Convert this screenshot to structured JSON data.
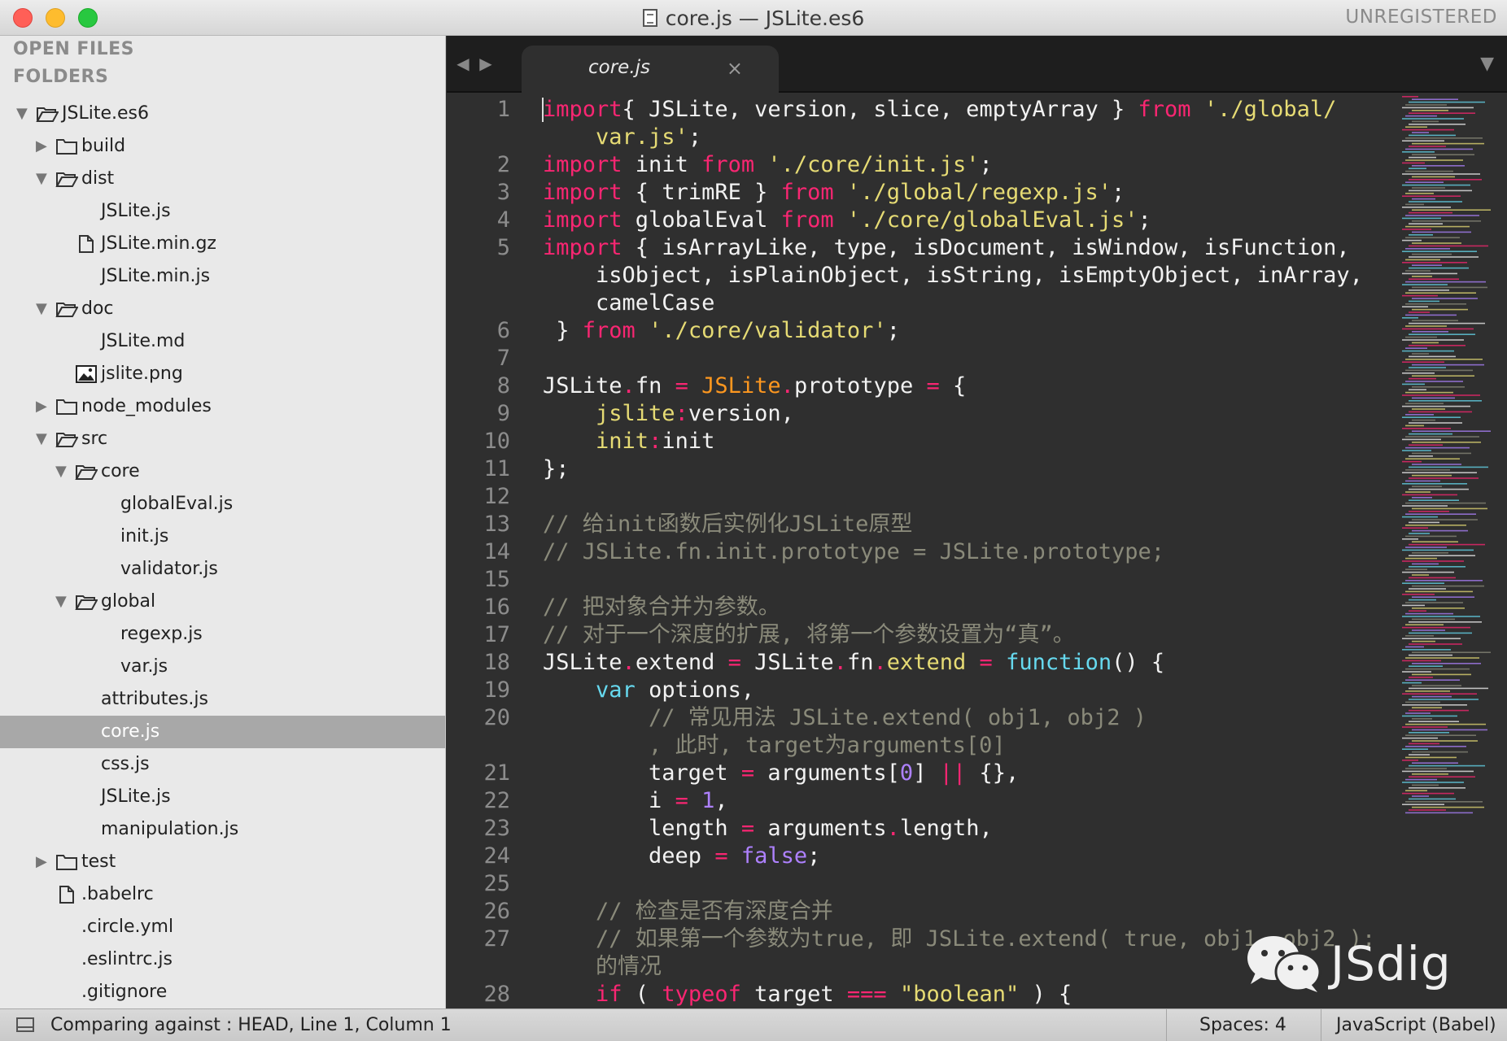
{
  "window": {
    "title": "core.js — JSLite.es6",
    "unregistered": "UNREGISTERED"
  },
  "sidebar": {
    "open_files_header": "OPEN FILES",
    "folders_header": "FOLDERS",
    "tree": [
      {
        "label": "JSLite.es6",
        "type": "folder-open",
        "depth": 0
      },
      {
        "label": "build",
        "type": "folder-closed",
        "depth": 1
      },
      {
        "label": "dist",
        "type": "folder-open",
        "depth": 1
      },
      {
        "label": "JSLite.js",
        "type": "file",
        "depth": 2
      },
      {
        "label": "JSLite.min.gz",
        "type": "file-icon",
        "depth": 2
      },
      {
        "label": "JSLite.min.js",
        "type": "file",
        "depth": 2
      },
      {
        "label": "doc",
        "type": "folder-open",
        "depth": 1
      },
      {
        "label": "JSLite.md",
        "type": "file",
        "depth": 2
      },
      {
        "label": "jslite.png",
        "type": "image-icon",
        "depth": 2
      },
      {
        "label": "node_modules",
        "type": "folder-closed",
        "depth": 1
      },
      {
        "label": "src",
        "type": "folder-open",
        "depth": 1
      },
      {
        "label": "core",
        "type": "folder-open",
        "depth": 2
      },
      {
        "label": "globalEval.js",
        "type": "file",
        "depth": 3
      },
      {
        "label": "init.js",
        "type": "file",
        "depth": 3
      },
      {
        "label": "validator.js",
        "type": "file",
        "depth": 3
      },
      {
        "label": "global",
        "type": "folder-open",
        "depth": 2
      },
      {
        "label": "regexp.js",
        "type": "file",
        "depth": 3
      },
      {
        "label": "var.js",
        "type": "file",
        "depth": 3
      },
      {
        "label": "attributes.js",
        "type": "file",
        "depth": 2
      },
      {
        "label": "core.js",
        "type": "file",
        "depth": 2,
        "selected": true
      },
      {
        "label": "css.js",
        "type": "file",
        "depth": 2
      },
      {
        "label": "JSLite.js",
        "type": "file",
        "depth": 2
      },
      {
        "label": "manipulation.js",
        "type": "file",
        "depth": 2
      },
      {
        "label": "test",
        "type": "folder-closed",
        "depth": 1
      },
      {
        "label": ".babelrc",
        "type": "file-icon",
        "depth": 1
      },
      {
        "label": ".circle.yml",
        "type": "file",
        "depth": 1
      },
      {
        "label": ".eslintrc.js",
        "type": "file",
        "depth": 1
      },
      {
        "label": ".gitignore",
        "type": "file",
        "depth": 1
      }
    ]
  },
  "editor": {
    "tab_label": "core.js",
    "tab_close": "×",
    "lines": [
      {
        "num": "1",
        "tokens": [
          [
            "k",
            "import"
          ],
          [
            "",
            "{ JSLite, version, slice, emptyArray } "
          ],
          [
            "k",
            "from"
          ],
          [
            "",
            " "
          ],
          [
            "s",
            "'./global/"
          ]
        ]
      },
      {
        "num": "",
        "tokens": [
          [
            "s",
            "    var.js'"
          ],
          [
            "",
            ";"
          ]
        ]
      },
      {
        "num": "2",
        "tokens": [
          [
            "k",
            "import"
          ],
          [
            "",
            " init "
          ],
          [
            "k",
            "from"
          ],
          [
            "",
            " "
          ],
          [
            "s",
            "'./core/init.js'"
          ],
          [
            "",
            ";"
          ]
        ]
      },
      {
        "num": "3",
        "tokens": [
          [
            "k",
            "import"
          ],
          [
            "",
            " { trimRE } "
          ],
          [
            "k",
            "from"
          ],
          [
            "",
            " "
          ],
          [
            "s",
            "'./global/regexp.js'"
          ],
          [
            "",
            ";"
          ]
        ]
      },
      {
        "num": "4",
        "tokens": [
          [
            "k",
            "import"
          ],
          [
            "",
            " globalEval "
          ],
          [
            "k",
            "from"
          ],
          [
            "",
            " "
          ],
          [
            "s",
            "'./core/globalEval.js'"
          ],
          [
            "",
            ";"
          ]
        ]
      },
      {
        "num": "5",
        "tokens": [
          [
            "k",
            "import"
          ],
          [
            "",
            " { isArrayLike, type, isDocument, isWindow, isFunction,"
          ]
        ]
      },
      {
        "num": "",
        "tokens": [
          [
            "",
            "    isObject, isPlainObject, isString, isEmptyObject, inArray,"
          ]
        ]
      },
      {
        "num": "",
        "tokens": [
          [
            "",
            "    camelCase"
          ]
        ]
      },
      {
        "num": "6",
        "tokens": [
          [
            "",
            " } "
          ],
          [
            "k",
            "from"
          ],
          [
            "",
            " "
          ],
          [
            "s",
            "'./core/validator'"
          ],
          [
            "",
            ";"
          ]
        ]
      },
      {
        "num": "7",
        "tokens": [
          [
            "",
            ""
          ]
        ]
      },
      {
        "num": "8",
        "tokens": [
          [
            "",
            "JSLite"
          ],
          [
            "o",
            "."
          ],
          [
            "",
            "fn "
          ],
          [
            "o",
            "="
          ],
          [
            "",
            " "
          ],
          [
            "p",
            "JSLite"
          ],
          [
            "o",
            "."
          ],
          [
            "",
            "prototype "
          ],
          [
            "o",
            "="
          ],
          [
            "",
            " {"
          ]
        ]
      },
      {
        "num": "9",
        "tokens": [
          [
            "",
            "    "
          ],
          [
            "s",
            "jslite"
          ],
          [
            "o",
            ":"
          ],
          [
            "",
            "version,"
          ]
        ]
      },
      {
        "num": "10",
        "tokens": [
          [
            "",
            "    "
          ],
          [
            "s",
            "init"
          ],
          [
            "o",
            ":"
          ],
          [
            "",
            "init"
          ]
        ]
      },
      {
        "num": "11",
        "tokens": [
          [
            "",
            "};"
          ]
        ]
      },
      {
        "num": "12",
        "tokens": [
          [
            "",
            ""
          ]
        ]
      },
      {
        "num": "13",
        "tokens": [
          [
            "c",
            "// 给init函数后实例化JSLite原型"
          ]
        ]
      },
      {
        "num": "14",
        "tokens": [
          [
            "c",
            "// JSLite.fn.init.prototype = JSLite.prototype;"
          ]
        ]
      },
      {
        "num": "15",
        "tokens": [
          [
            "",
            ""
          ]
        ]
      },
      {
        "num": "16",
        "tokens": [
          [
            "c",
            "// 把对象合并为参数。"
          ]
        ]
      },
      {
        "num": "17",
        "tokens": [
          [
            "c",
            "// 对于一个深度的扩展, 将第一个参数设置为“真”。"
          ]
        ]
      },
      {
        "num": "18",
        "tokens": [
          [
            "",
            "JSLite"
          ],
          [
            "o",
            "."
          ],
          [
            "",
            "extend "
          ],
          [
            "o",
            "="
          ],
          [
            "",
            " JSLite"
          ],
          [
            "o",
            "."
          ],
          [
            "",
            "fn"
          ],
          [
            "o",
            "."
          ],
          [
            "s",
            "extend"
          ],
          [
            "",
            " "
          ],
          [
            "o",
            "="
          ],
          [
            "",
            " "
          ],
          [
            "f",
            "function"
          ],
          [
            "",
            "() {"
          ]
        ]
      },
      {
        "num": "19",
        "tokens": [
          [
            "",
            "    "
          ],
          [
            "f",
            "var"
          ],
          [
            "",
            " options,"
          ]
        ]
      },
      {
        "num": "20",
        "tokens": [
          [
            "c",
            "        // 常见用法 JSLite.extend( obj1, obj2 )"
          ]
        ]
      },
      {
        "num": "",
        "tokens": [
          [
            "c",
            "        , 此时, target为arguments[0]"
          ]
        ]
      },
      {
        "num": "21",
        "tokens": [
          [
            "",
            "        target "
          ],
          [
            "o",
            "="
          ],
          [
            "",
            " arguments["
          ],
          [
            "n",
            "0"
          ],
          [
            "",
            "] "
          ],
          [
            "o",
            "||"
          ],
          [
            "",
            " {},"
          ]
        ]
      },
      {
        "num": "22",
        "tokens": [
          [
            "",
            "        i "
          ],
          [
            "o",
            "="
          ],
          [
            "",
            " "
          ],
          [
            "n",
            "1"
          ],
          [
            "",
            ","
          ]
        ]
      },
      {
        "num": "23",
        "tokens": [
          [
            "",
            "        length "
          ],
          [
            "o",
            "="
          ],
          [
            "",
            " arguments"
          ],
          [
            "o",
            "."
          ],
          [
            "",
            "length,"
          ]
        ]
      },
      {
        "num": "24",
        "tokens": [
          [
            "",
            "        deep "
          ],
          [
            "o",
            "="
          ],
          [
            "",
            " "
          ],
          [
            "n",
            "false"
          ],
          [
            "",
            ";"
          ]
        ]
      },
      {
        "num": "25",
        "tokens": [
          [
            "",
            ""
          ]
        ]
      },
      {
        "num": "26",
        "tokens": [
          [
            "c",
            "    // 检查是否有深度合并"
          ]
        ]
      },
      {
        "num": "27",
        "tokens": [
          [
            "c",
            "    // 如果第一个参数为true, 即 JSLite.extend( true, obj1, obj2 );"
          ]
        ]
      },
      {
        "num": "",
        "tokens": [
          [
            "c",
            "    的情况"
          ]
        ]
      },
      {
        "num": "28",
        "tokens": [
          [
            "",
            "    "
          ],
          [
            "k",
            "if"
          ],
          [
            "",
            " ( "
          ],
          [
            "k",
            "typeof"
          ],
          [
            "",
            " target "
          ],
          [
            "o",
            "==="
          ],
          [
            "",
            " "
          ],
          [
            "s",
            "\"boolean\""
          ],
          [
            "",
            " ) {"
          ]
        ]
      }
    ]
  },
  "watermark": {
    "text": "JSdig"
  },
  "statusbar": {
    "left": "Comparing against : HEAD, Line 1, Column 1",
    "spaces": "Spaces: 4",
    "syntax": "JavaScript (Babel)"
  }
}
